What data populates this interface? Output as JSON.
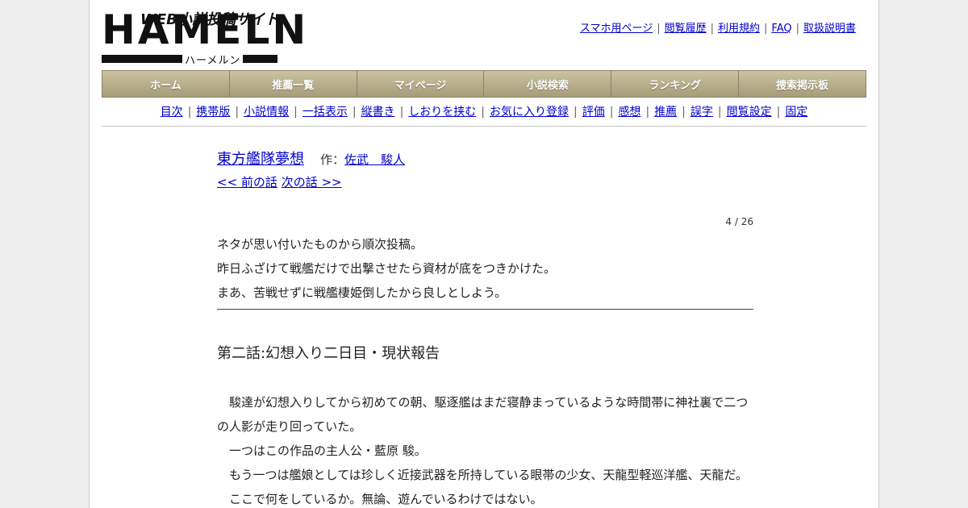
{
  "logo": {
    "tagline": "WEB小説投稿サイト",
    "wordmark": "HAMELN",
    "kana": "ハーメルン"
  },
  "top_links": [
    "スマホ用ページ",
    "閲覧履歴",
    "利用規約",
    "FAQ",
    "取扱説明書"
  ],
  "main_nav": [
    "ホーム",
    "推薦一覧",
    "マイページ",
    "小説検索",
    "ランキング",
    "捜索掲示板"
  ],
  "sub_nav": [
    "目次",
    "携帯版",
    "小説情報",
    "一括表示",
    "縦書き",
    "しおりを挟む",
    "お気に入り登録",
    "評価",
    "感想",
    "推薦",
    "誤字",
    "閲覧設定",
    "固定"
  ],
  "work": {
    "title": "東方艦隊夢想",
    "author_label": "作：",
    "author": "佐武　駿人"
  },
  "pager": {
    "prev": "<< 前の話",
    "next": "次の話 >>"
  },
  "page_count": "4 / 26",
  "preface": [
    "ネタが思い付いたものから順次投稿。",
    "昨日ふざけて戦艦だけで出撃させたら資材が底をつきかけた。",
    "まあ、苦戦せずに戦艦棲姫倒したから良しとしよう。"
  ],
  "chapter_title": "第二話:幻想入り二日目・現状報告",
  "body": [
    "　駿達が幻想入りしてから初めての朝、駆逐艦はまだ寝静まっているような時間帯に神社裏で二つの人影が走り回っていた。",
    "　一つはこの作品の主人公・藍原 駿。",
    "　もう一つは艦娘としては珍しく近接武器を所持している眼帯の少女、天龍型軽巡洋艦、天龍だ。",
    "　ここで何をしているか。無論、遊んでいるわけではない。"
  ],
  "colors": {
    "nav_gradient_top": "#cbc3a2",
    "nav_gradient_bottom": "#a59c79",
    "link": "#0000cc"
  }
}
